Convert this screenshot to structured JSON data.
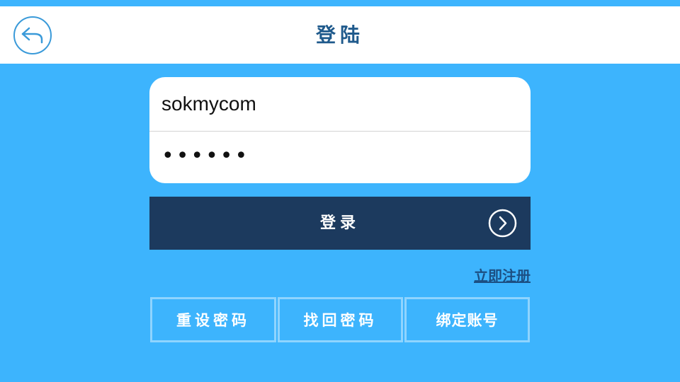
{
  "header": {
    "title": "登陆",
    "back_icon": "back-arrow-icon"
  },
  "form": {
    "username_value": "sokmycom",
    "password_mask": "••••••"
  },
  "login_button": {
    "label": "登录",
    "arrow_icon": "chevron-right-circle-icon"
  },
  "register_link": "立即注册",
  "actions": [
    {
      "label": "重设密码"
    },
    {
      "label": "找回密码"
    },
    {
      "label": "绑定账号"
    }
  ],
  "colors": {
    "background": "#3db4fd",
    "header_bg": "#ffffff",
    "title": "#1f5a8c",
    "login_button": "#1c3a5e",
    "link": "#1c4f82",
    "action_border": "#8fd4fe"
  }
}
